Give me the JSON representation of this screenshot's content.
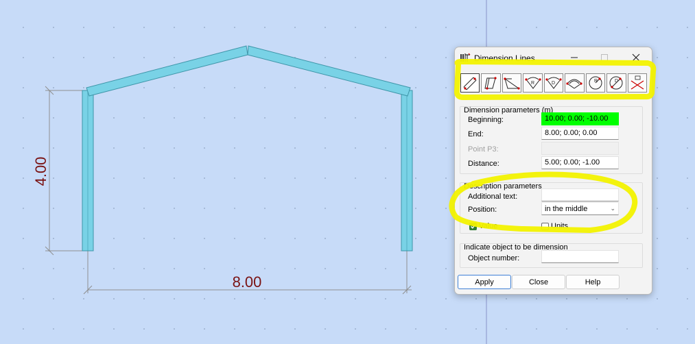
{
  "drawing": {
    "vertical_dimension": "4.00",
    "horizontal_dimension": "8.00",
    "colors": {
      "member": "#79d2e6",
      "member_edge": "#3d95a8",
      "dimension_text": "#7a1313",
      "dim_line": "#9a9a9a"
    }
  },
  "dialog": {
    "title": "Dimension Lines",
    "toolbar_icons": [
      "linear-dimension-icon",
      "perpendicular-dimension-icon",
      "angular-dimension-icon",
      "radius-dimension-icon",
      "radius-dimension-2-icon",
      "arc-length-dimension-icon",
      "circle-radius-dimension-icon",
      "circle-diameter-dimension-icon",
      "delete-dimension-icon"
    ],
    "dimension_params": {
      "title": "Dimension parameters (m)",
      "beginning_label": "Beginning:",
      "beginning_value": "10.00; 0.00; -10.00",
      "end_label": "End:",
      "end_value": "8.00; 0.00; 0.00",
      "p3_label": "Point P3:",
      "p3_value": "",
      "distance_label": "Distance:",
      "distance_value": "5.00; 0.00; -1.00"
    },
    "description_params": {
      "title": "Description parameters",
      "additional_text_label": "Additional text:",
      "additional_text_value": "",
      "position_label": "Position:",
      "position_value": "in the middle",
      "value_label": "Value",
      "value_checked": true,
      "units_label": "Units",
      "units_checked": false
    },
    "indicate": {
      "title": "Indicate object to be dimension",
      "object_number_label": "Object number:",
      "object_number_value": ""
    },
    "buttons": {
      "apply": "Apply",
      "close": "Close",
      "help": "Help"
    },
    "colors": {
      "highlight": "#f2f200",
      "green_field": "#00ff00"
    }
  }
}
